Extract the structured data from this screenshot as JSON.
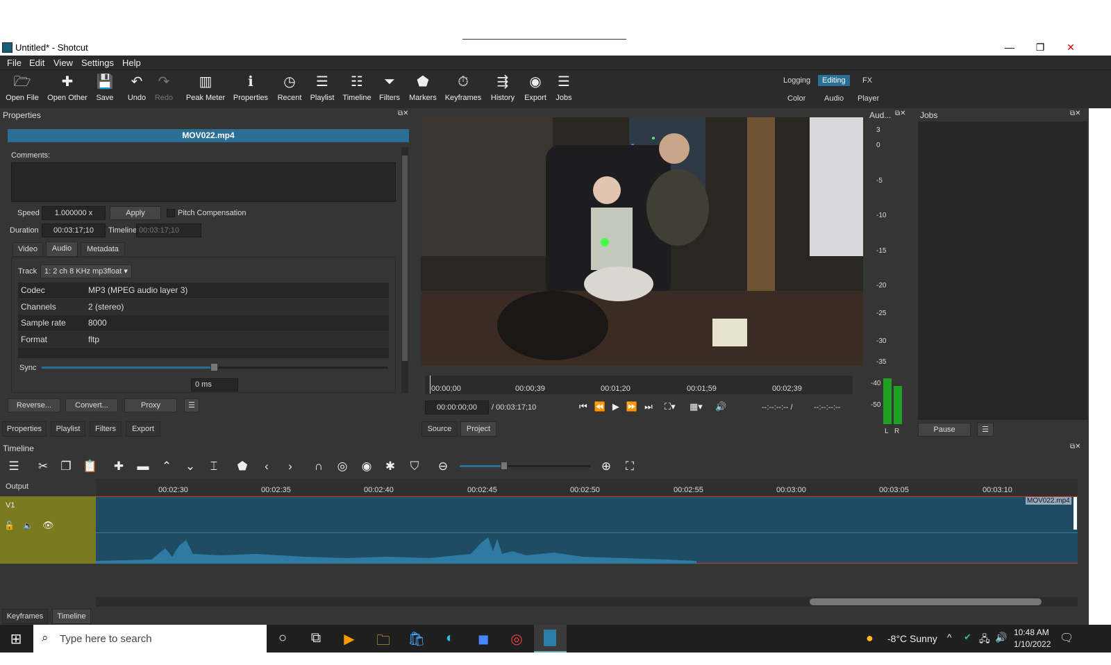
{
  "window": {
    "title": "Untitled* - Shotcut",
    "minimize": "—",
    "restore": "❐",
    "close": "✕"
  },
  "menu": [
    "File",
    "Edit",
    "View",
    "Settings",
    "Help"
  ],
  "toolbar": [
    {
      "label": "Open File",
      "icon": "folder-icon",
      "glyph": "🗁"
    },
    {
      "label": "Open Other",
      "icon": "open-other-icon",
      "glyph": "✚"
    },
    {
      "label": "Save",
      "icon": "save-icon",
      "glyph": "💾"
    },
    {
      "label": "Undo",
      "icon": "undo-icon",
      "glyph": "↶"
    },
    {
      "label": "Redo",
      "icon": "redo-icon",
      "glyph": "↷"
    },
    {
      "label": "Peak Meter",
      "icon": "peak-meter-icon",
      "glyph": "▥"
    },
    {
      "label": "Properties",
      "icon": "info-icon",
      "glyph": "ℹ"
    },
    {
      "label": "Recent",
      "icon": "clock-icon",
      "glyph": "◷"
    },
    {
      "label": "Playlist",
      "icon": "list-icon",
      "glyph": "☰"
    },
    {
      "label": "Timeline",
      "icon": "timeline-icon",
      "glyph": "☷"
    },
    {
      "label": "Filters",
      "icon": "funnel-icon",
      "glyph": "⏷"
    },
    {
      "label": "Markers",
      "icon": "marker-icon",
      "glyph": "⬟"
    },
    {
      "label": "Keyframes",
      "icon": "stopwatch-icon",
      "glyph": "⏱"
    },
    {
      "label": "History",
      "icon": "history-icon",
      "glyph": "⇶"
    },
    {
      "label": "Export",
      "icon": "export-icon",
      "glyph": "◉"
    },
    {
      "label": "Jobs",
      "icon": "jobs-icon",
      "glyph": "☰"
    }
  ],
  "layouts": {
    "row1": [
      "Logging",
      "Editing",
      "FX"
    ],
    "row2": [
      "Color",
      "Audio",
      "Player"
    ]
  },
  "properties": {
    "panel_title": "Properties",
    "clip_name": "MOV022.mp4",
    "comments_label": "Comments:",
    "speed_label": "Speed",
    "speed_value": "1.000000 x",
    "apply": "Apply",
    "pitch": "Pitch Compensation",
    "duration_label": "Duration",
    "duration_value": "00:03:17;10",
    "timeline_label": "Timeline",
    "timeline_value": "00:03:17;10",
    "tabs": [
      "Video",
      "Audio",
      "Metadata"
    ],
    "track_label": "Track",
    "track_value": "1: 2 ch 8 KHz mp3float",
    "info": [
      {
        "key": "Codec",
        "value": "MP3 (MPEG audio layer 3)"
      },
      {
        "key": "Channels",
        "value": "2 (stereo)"
      },
      {
        "key": "Sample rate",
        "value": "8000"
      },
      {
        "key": "Format",
        "value": "fltp"
      }
    ],
    "sync_label": "Sync",
    "sync_value": "0 ms",
    "buttons": [
      "Reverse...",
      "Convert...",
      "Proxy"
    ],
    "bottom_tabs": [
      "Properties",
      "Playlist",
      "Filters",
      "Export"
    ]
  },
  "player": {
    "ruler": [
      "00:00;00",
      "00:00;39",
      "00:01;20",
      "00:01;59",
      "00:02;39"
    ],
    "position": "00:00:00;00",
    "duration": "/ 00:03:17;10",
    "in_point": "--:--:--:-- /",
    "out_point": "--:--:--:--",
    "tabs": [
      "Source",
      "Project"
    ]
  },
  "audio_meter": {
    "title": "Aud...",
    "scale": [
      "3",
      "0",
      "-5",
      "-10",
      "-15",
      "-20",
      "-25",
      "-30",
      "-35",
      "-40",
      "-50"
    ],
    "left": "L",
    "right": "R"
  },
  "jobs": {
    "title": "Jobs",
    "pause": "Pause"
  },
  "timeline": {
    "title": "Timeline",
    "output": "Output",
    "track": "V1",
    "ruler": [
      "00:02:30",
      "00:02:35",
      "00:02:40",
      "00:02:45",
      "00:02:50",
      "00:02:55",
      "00:03:00",
      "00:03:05",
      "00:03:10"
    ],
    "clip_name": "MOV022.mp4",
    "bottom_tabs": [
      "Keyframes",
      "Timeline"
    ]
  },
  "taskbar": {
    "search_placeholder": "Type here to search",
    "weather": "-8°C  Sunny",
    "time": "10:48 AM",
    "date": "1/10/2022"
  },
  "colors": {
    "accent": "#2c6f95",
    "panel": "#353535",
    "track": "#7a7a1e",
    "clip": "#1e4d63"
  }
}
